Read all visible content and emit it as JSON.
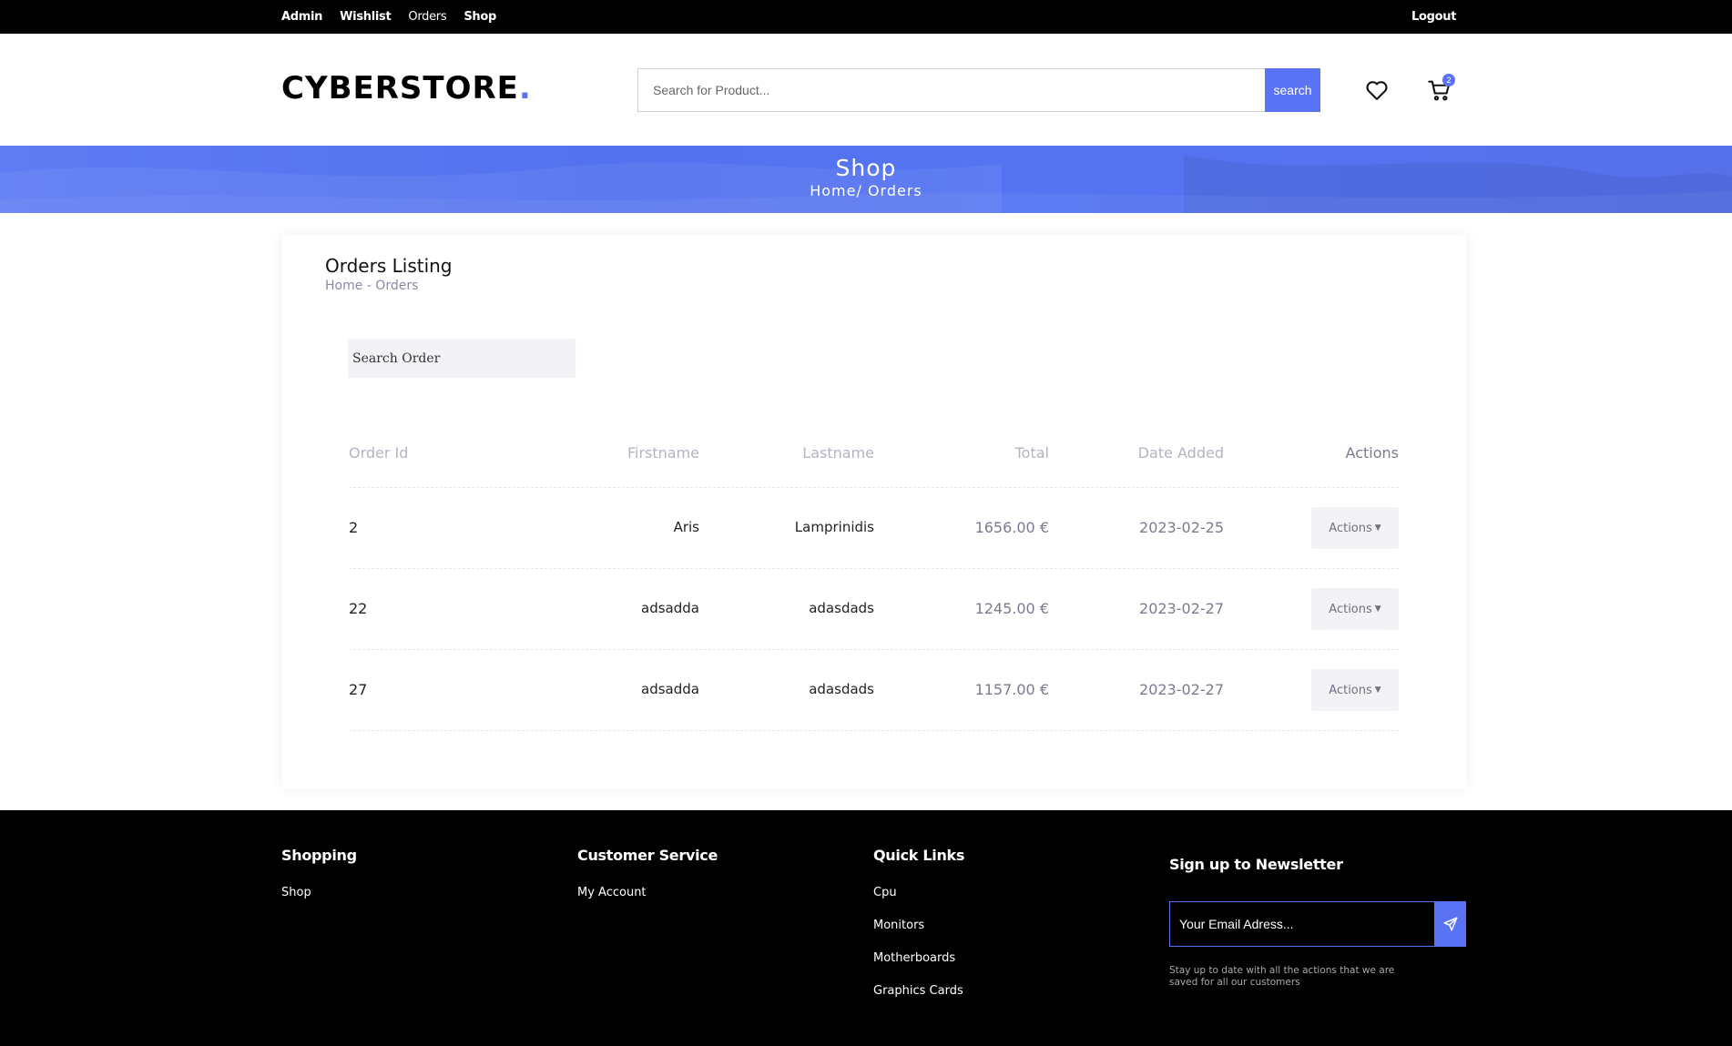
{
  "topnav": {
    "items": [
      {
        "label": "Admin"
      },
      {
        "label": "Wishlist"
      },
      {
        "label": "Orders"
      },
      {
        "label": "Shop"
      }
    ],
    "logout": "Logout"
  },
  "header": {
    "logo_text": "CYBERSTORE",
    "logo_dot": ".",
    "search_placeholder": "Search for Product...",
    "search_button": "search",
    "cart_count": "2"
  },
  "banner": {
    "title": "Shop",
    "breadcrumb": "Home/ Orders"
  },
  "orders": {
    "title": "Orders Listing",
    "breadcrumb": "Home - Orders",
    "search_placeholder": "Search Order",
    "columns": [
      "Order Id",
      "Firstname",
      "Lastname",
      "Total",
      "Date Added",
      "Actions"
    ],
    "rows": [
      {
        "id": "2",
        "firstname": "Aris",
        "lastname": "Lamprinidis",
        "total": "1656.00 €",
        "date": "2023-02-25",
        "action": "Actions"
      },
      {
        "id": "22",
        "firstname": "adsadda",
        "lastname": "adasdads",
        "total": "1245.00 €",
        "date": "2023-02-27",
        "action": "Actions"
      },
      {
        "id": "27",
        "firstname": "adsadda",
        "lastname": "adasdads",
        "total": "1157.00 €",
        "date": "2023-02-27",
        "action": "Actions"
      }
    ]
  },
  "footer": {
    "shopping": {
      "title": "Shopping",
      "links": [
        "Shop"
      ]
    },
    "customer_service": {
      "title": "Customer Service",
      "links": [
        "My Account"
      ]
    },
    "quick_links": {
      "title": "Quick Links",
      "links": [
        "Cpu",
        "Monitors",
        "Motherboards",
        "Graphics Cards"
      ]
    },
    "newsletter": {
      "title": "Sign up to Newsletter",
      "placeholder": "Your Email Adress...",
      "note": "Stay up to date with all the actions that we are saved for all our customers"
    }
  },
  "colors": {
    "accent": "#5a72f4",
    "topbar": "#000000",
    "footer": "#000000"
  }
}
